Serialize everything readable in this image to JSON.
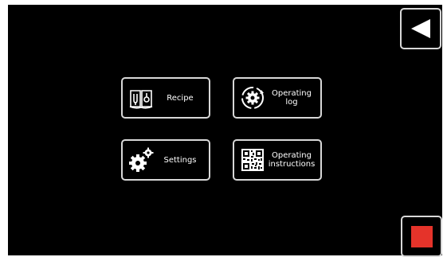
{
  "menu": {
    "recipe_label": "Recipe",
    "operating_log_label": "Operating\nlog",
    "settings_label": "Settings",
    "operating_instructions_label": "Operating\ninstructions"
  },
  "icons": {
    "back": "back-arrow-icon",
    "recipe": "recipe-book-icon",
    "operating_log": "gear-cycle-icon",
    "settings": "gears-icon",
    "operating_instructions": "qr-code-icon",
    "stop": "stop-icon"
  },
  "colors": {
    "background": "#000000",
    "border": "#d8d8d8",
    "stop": "#e5332a",
    "text": "#ffffff"
  }
}
